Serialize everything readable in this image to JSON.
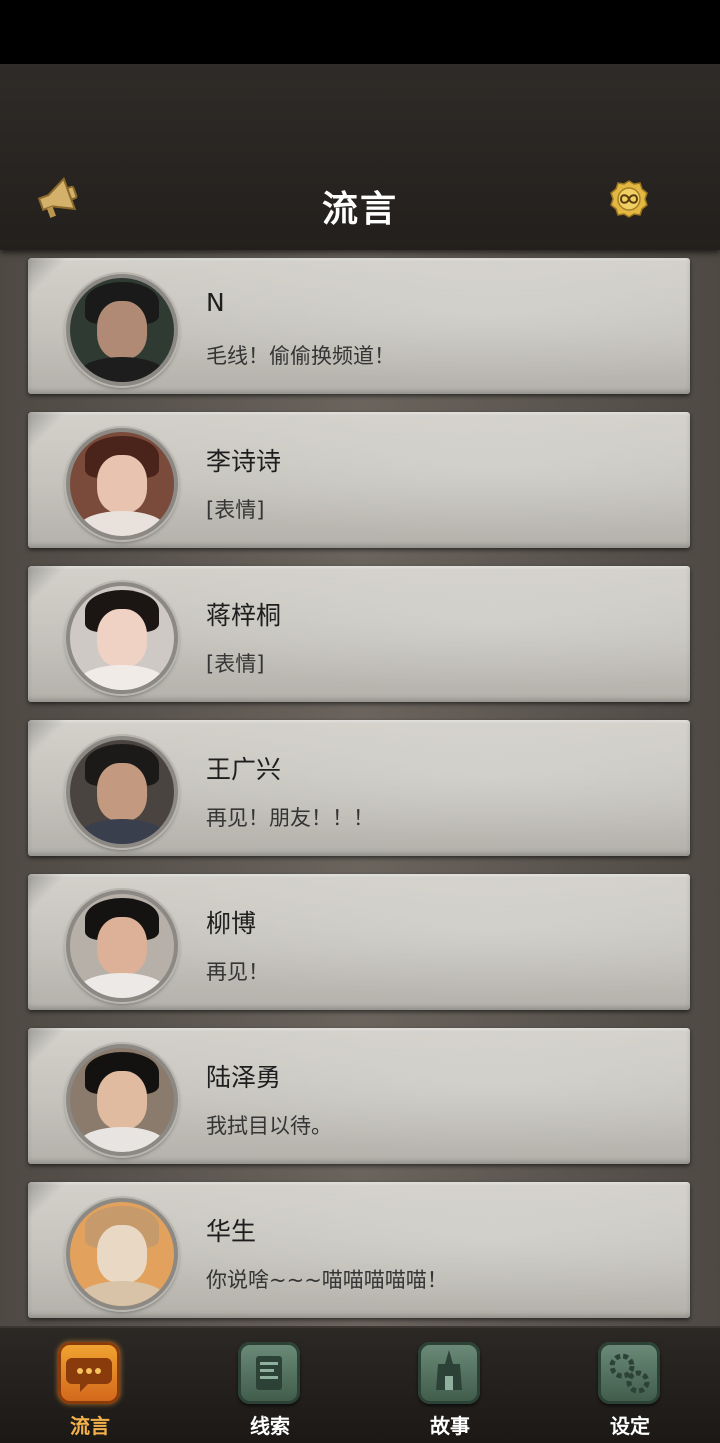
{
  "header": {
    "title": "流言"
  },
  "contacts": [
    {
      "name": "N",
      "message": "毛线！偷偷换频道！",
      "avatar": {
        "bg": "#2f3a33",
        "face": "#b08a74",
        "hair": "#1a1a1a",
        "body": "#1d1d1d"
      }
    },
    {
      "name": "李诗诗",
      "message": "[表情]",
      "avatar": {
        "bg": "#7a4a3a",
        "face": "#e8c3b0",
        "hair": "#4a231b",
        "body": "#e9e1dc"
      }
    },
    {
      "name": "蒋梓桐",
      "message": "[表情]",
      "avatar": {
        "bg": "#cfc9c5",
        "face": "#efd2c3",
        "hair": "#1b1514",
        "body": "#f1ebe8"
      }
    },
    {
      "name": "王广兴",
      "message": "再见！朋友！！！",
      "avatar": {
        "bg": "#4a4440",
        "face": "#c39a7f",
        "hair": "#1c1a18",
        "body": "#3a3f4e"
      }
    },
    {
      "name": "柳博",
      "message": "再见！",
      "avatar": {
        "bg": "#b7b0a8",
        "face": "#dcb197",
        "hair": "#151312",
        "body": "#ede9e6"
      }
    },
    {
      "name": "陆泽勇",
      "message": "我拭目以待。",
      "avatar": {
        "bg": "#8b7b6c",
        "face": "#e1bb9f",
        "hair": "#141211",
        "body": "#e7e4e1"
      }
    },
    {
      "name": "华生",
      "message": "你说啥~~~喵喵喵喵喵！",
      "avatar": {
        "bg": "#e2a15c",
        "face": "#e9d8c3",
        "hair": "#c69a6a",
        "body": "#d8c3a8"
      }
    }
  ],
  "tabs": [
    {
      "label": "流言",
      "icon": "speech-bubble-icon",
      "active": true
    },
    {
      "label": "线索",
      "icon": "scroll-icon",
      "active": false
    },
    {
      "label": "故事",
      "icon": "temple-icon",
      "active": false
    },
    {
      "label": "设定",
      "icon": "gears-icon",
      "active": false
    }
  ],
  "colors": {
    "header_bg": "#2a2623",
    "card_bg": "#cbc9c2",
    "active_tab": "#f6b24a"
  }
}
